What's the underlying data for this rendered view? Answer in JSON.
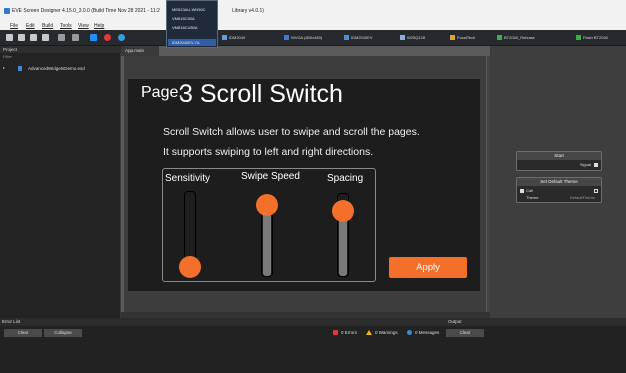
{
  "window": {
    "title": "EVE Screen Designer 4.15.0_3.0.0 (Build Time Nov 28 2021 - 11:2",
    "title_tail": "Library v4.0.1)"
  },
  "menu": [
    "File",
    "Edit",
    "Build",
    "Tools",
    "View",
    "Help"
  ],
  "device_dropdown": {
    "options": [
      "ME813AU-WH50C",
      "VM816C50A",
      "VM816CU50A",
      "IDM2040EV-7A"
    ],
    "selected_index": 3
  },
  "toolbar": {
    "items": [
      "IDM2040",
      "WVGA (800x480)",
      "IDM2040EV",
      "W25Q128",
      "FocalTech",
      "BT2040_Release",
      "Flash BT2040"
    ]
  },
  "project_panel": {
    "header": "Project",
    "filter": "Filter",
    "tree_item": "AdvancedWidgetsDemo.esd"
  },
  "editor_tab": "App.main",
  "screen": {
    "page_label": "Page:",
    "page_title": "3 Scroll Switch",
    "line1": "Scroll Switch allows user to swipe and scroll the pages.",
    "line2": "It supports swiping to left and right directions.",
    "sliders": [
      {
        "label": "Sensitivity",
        "level": 0.0
      },
      {
        "label": "Swipe Speed",
        "level": 1.0
      },
      {
        "label": "Spacing",
        "level": 0.82
      }
    ],
    "apply_label": "Apply"
  },
  "logic_nodes": {
    "start": {
      "title": "Start",
      "port": "Signal"
    },
    "theme": {
      "title": "Set Default Theme",
      "port_in": "Call",
      "port_out": "Theme",
      "value": "DefaultTheme"
    }
  },
  "bottom": {
    "error_list": "Error List",
    "clear": "Clear",
    "collapse": "Collapse",
    "errors": "0 Errors",
    "warnings": "0 Warnings",
    "messages": "0 Messages",
    "output": "Output",
    "clear2": "Clear"
  },
  "colors": {
    "accent": "#f36f2a",
    "selection": "#2f5fa8"
  }
}
